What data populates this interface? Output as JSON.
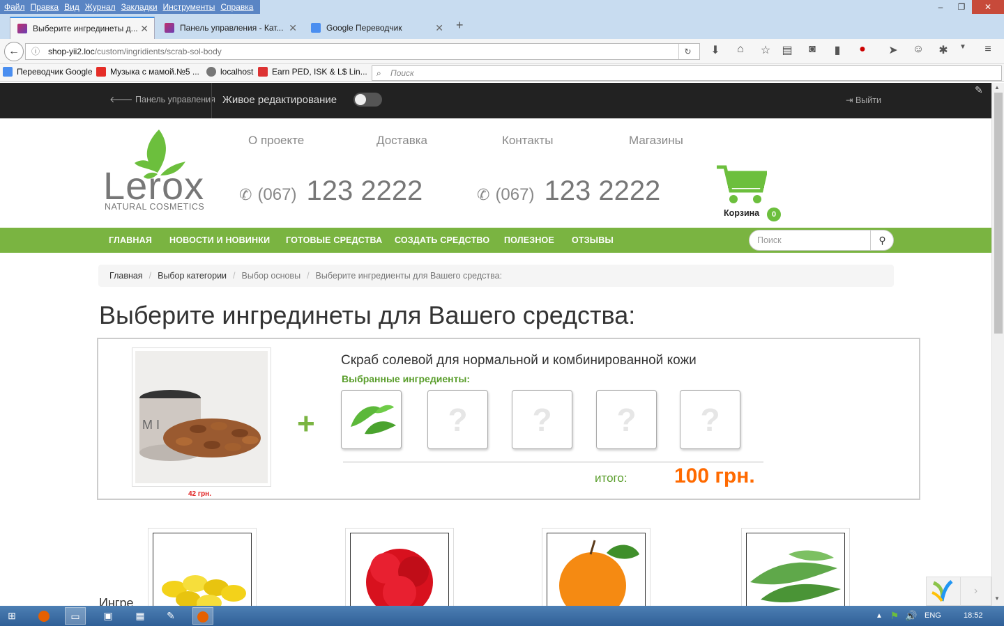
{
  "menubar": {
    "items": [
      "Файл",
      "Правка",
      "Вид",
      "Журнал",
      "Закладки",
      "Инструменты",
      "Справка"
    ]
  },
  "tabs": [
    {
      "label": "Выберите ингрединеты д...",
      "active": true
    },
    {
      "label": "Панель управления - Кат...",
      "active": false
    },
    {
      "label": "Google Переводчик",
      "active": false
    }
  ],
  "url": {
    "host": "shop-yii2.loc",
    "path": "/custom/ingridients/scrab-sol-body"
  },
  "bookmarks": [
    "Переводчик Google",
    "Музыка с мамой.№5 ...",
    "localhost",
    "Earn PED, ISK & L$ Lin..."
  ],
  "browser_search_placeholder": "Поиск",
  "admin": {
    "panel": "Панель управления",
    "live_edit": "Живое редактирование",
    "logout": "Выйти"
  },
  "site": {
    "logo": {
      "name": "Lerox",
      "tagline": "NATURAL COSMETICS"
    },
    "top_nav": [
      "О проекте",
      "Доставка",
      "Контакты",
      "Магазины"
    ],
    "phones": [
      {
        "code": "(067)",
        "number": "123 2222"
      },
      {
        "code": "(067)",
        "number": "123 2222"
      }
    ],
    "cart": {
      "label": "Корзина",
      "count": "0"
    },
    "main_nav": [
      "ГЛАВНАЯ",
      "НОВОСТИ И НОВИНКИ",
      "ГОТОВЫЕ СРЕДСТВА",
      "СОЗДАТЬ СРЕДСТВО",
      "ПОЛЕЗНОЕ",
      "ОТЗЫВЫ"
    ],
    "search_placeholder": "Поиск"
  },
  "breadcrumb": [
    "Главная",
    "Выбор категории",
    "Выбор основы",
    "Выберите ингредиенты для Вашего средства:"
  ],
  "page_title": "Выберите ингрединеты для Вашего средства:",
  "product": {
    "name": "Скраб солевой для нормальной и  комбинированной кожи",
    "base_price": "42 грн.",
    "selected_label": "Выбранные ингредиенты:",
    "slot_placeholder": "?",
    "total_label": "итого:",
    "total": "100 грн."
  },
  "partial_heading": "Ингре",
  "taskbar": {
    "lang": "ENG",
    "time": "18:52"
  },
  "colors": {
    "green": "#7ab441",
    "orange": "#ff6a00",
    "dark": "#222222"
  }
}
